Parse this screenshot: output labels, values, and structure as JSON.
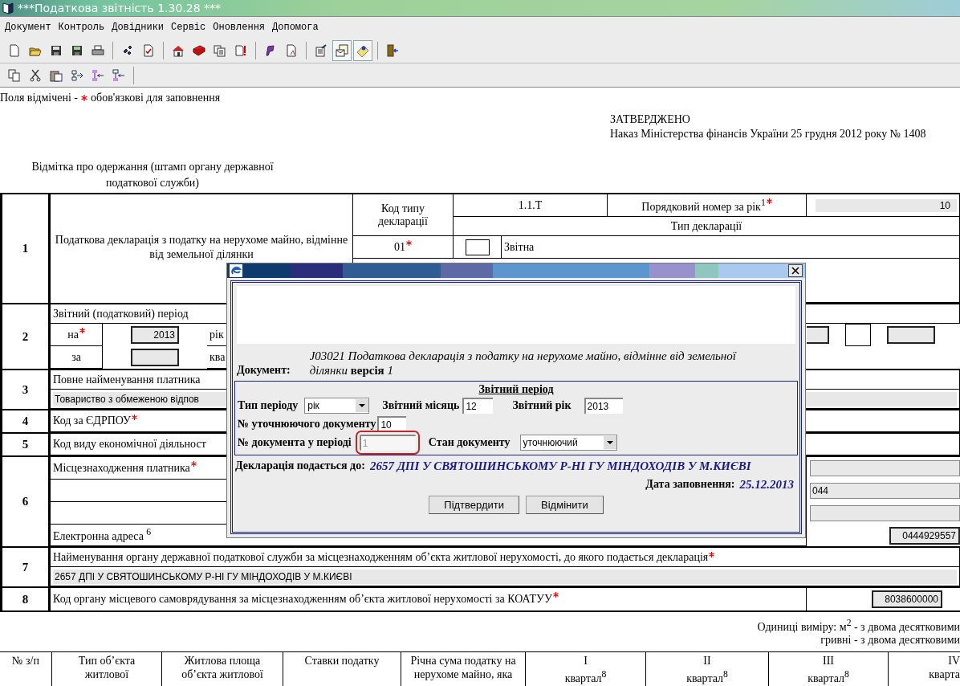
{
  "window": {
    "title": "***Податкова звітність 1.30.28 ***"
  },
  "menu": [
    "Документ",
    "Контроль",
    "Довідники",
    "Сервіс",
    "Оновлення",
    "Допомога"
  ],
  "toolbar": [
    {
      "pressed": false
    },
    {
      "pressed": false
    },
    {
      "pressed": false
    },
    {
      "pressed": false
    },
    {
      "pressed": false
    },
    {
      "pressed": false
    },
    {
      "pressed": false
    },
    {
      "pressed": false
    },
    {
      "pressed": false
    },
    {
      "pressed": false
    },
    {
      "pressed": false
    },
    {
      "pressed": false
    },
    {
      "pressed": false
    },
    {
      "pressed": false
    },
    {
      "pressed": true
    },
    {
      "pressed": true
    },
    {
      "pressed": false
    }
  ],
  "toolbar_2": [
    {
      "pressed": false
    },
    {
      "pressed": false
    },
    {
      "pressed": false
    },
    {
      "pressed": false
    },
    {
      "pressed": false
    },
    {
      "pressed": false
    }
  ],
  "notice": {
    "before": "Поля відмічені -",
    "after": "обов'язкові для заповнення"
  },
  "approval": {
    "title": "ЗАТВЕРДЖЕНО",
    "order": "Наказ Міністерства фінансів України 25 грудня 2012 року № 1408"
  },
  "stamp_note": "Відмітка про одержання (штамп органу державної податкової служби)",
  "s1": {
    "number": "1",
    "title": "Податкова декларація з податку на нерухоме майно, відмінне від земельної ділянки",
    "type_code_label": "Код типу декларації",
    "type_code": "01",
    "type_code_required": true,
    "form_code": "1.1.Т",
    "serial_label": "Порядковий номер за рік$^{1}$",
    "serial_required": true,
    "serial": "10",
    "declaration_type_label": "Тип декларації",
    "declaration_type": {
      "label": "Звітна",
      "checked": false
    }
  },
  "s2": {
    "number": "2",
    "title": "Звітний (податковий) період",
    "rows": [
      {
        "label": "на",
        "required": true,
        "value": "2013",
        "unit": "рік"
      },
      {
        "label": "за",
        "required": false,
        "unit": "ква"
      }
    ]
  },
  "s3": {
    "number": "3",
    "label": "Повне найменування платника",
    "value": "Товариство з обмеженою відпов"
  },
  "s4": {
    "number": "4",
    "label": "Код за ЄДРПОУ",
    "required": true
  },
  "s5": {
    "number": "5",
    "label": "Код виду економічної діяльност",
    "required": false
  },
  "s6": {
    "number": "6",
    "label": "Місцезнаходження платника",
    "required": true,
    "email_label": "Електронна адреса $^{6}$",
    "phone_code": "044",
    "fax": "0444929557"
  },
  "s7": {
    "number": "7",
    "label": "Найменування органу державної податкової служби за місцезнаходженням об’єкта житлової нерухомості, до якого подається декларація",
    "required": true,
    "value": "2657 ДПІ У СВЯТОШИНСЬКОМУ Р-НІ ГУ МІНДОХОДІВ У М.КИЄВІ"
  },
  "s8": {
    "number": "8",
    "label": "Код органу місцевого самоврядування за місцезнаходженням об’єкта житлової нерухомості за КОАТУУ",
    "required": true,
    "value": "8038600000"
  },
  "units": [
    "Одиниці виміру:  м$^{2}$ - з двома десятковими",
    "гривні  - з двома десятковими"
  ],
  "table": {
    "columns": [
      [
        "№ з/п"
      ],
      [
        "Тип об’єкта",
        "житлової"
      ],
      [
        "Житлова площа",
        "об’єкта  житлової"
      ],
      [
        "Ставки податку"
      ],
      [
        "Річна сума податку на",
        "нерухоме майно, яка"
      ],
      [
        "I",
        "квартал$^{8}$"
      ],
      [
        "II",
        "квартал$^{8}$"
      ],
      [
        "III",
        "квартал$^{8}$"
      ],
      [
        "IV",
        "кварта"
      ]
    ]
  },
  "dialog": {
    "document_label": "Документ:",
    "document": "*J03021 Податкова декларація з податку на нерухоме майно, відмінне від земельної ділянки*  **версія** *1*",
    "period_title": "Звітний період",
    "period_type_label": "Тип періоду",
    "period_type": "рік",
    "month_label": "Звітний місяць",
    "month": "12",
    "year_label": "Звітний рік",
    "year": "2013",
    "correction_label": "№ уточнюючого документу",
    "correction": "10",
    "doc_number_label": "№ документа у періоді",
    "doc_number": "1",
    "doc_number_disabled": true,
    "doc_number_highlighted": true,
    "state_label": "Стан документу",
    "state": "уточнюючий",
    "submit_label": "Декларація подається до:",
    "submit_to": "2657  ДПІ У СВЯТОШИНСЬКОМУ Р-НІ ГУ МІНДОХОДІВ У М.КИЄВІ",
    "date_label": "Дата заповнення:",
    "date": "25.12.2013",
    "buttons": [
      "Підтвердити",
      "Відмінити"
    ]
  }
}
